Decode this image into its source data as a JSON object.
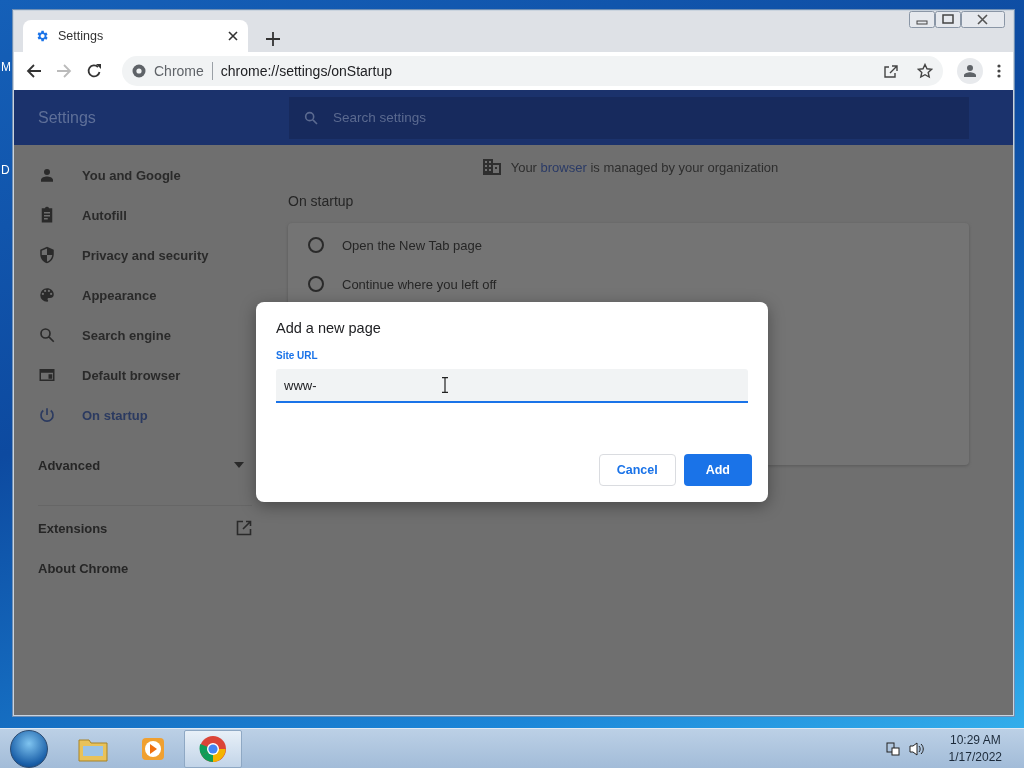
{
  "desktop": {
    "edge_labels": [
      "M",
      "D"
    ]
  },
  "browser": {
    "tabs": [
      {
        "title": "Settings",
        "selected": true
      }
    ],
    "omnibox": {
      "chip": "Chrome",
      "url": "chrome://settings/onStartup"
    }
  },
  "settings": {
    "title": "Settings",
    "search": {
      "placeholder": "Search settings"
    },
    "sidebar": {
      "items": [
        {
          "label": "You and Google",
          "kind": "person",
          "selected": false
        },
        {
          "label": "Autofill",
          "kind": "clipboard",
          "selected": false
        },
        {
          "label": "Privacy and security",
          "kind": "shield",
          "selected": false
        },
        {
          "label": "Appearance",
          "kind": "palette",
          "selected": false
        },
        {
          "label": "Search engine",
          "kind": "search",
          "selected": false
        },
        {
          "label": "Default browser",
          "kind": "browser",
          "selected": false
        },
        {
          "label": "On startup",
          "kind": "power",
          "selected": true
        }
      ],
      "advanced": {
        "label": "Advanced",
        "expanded": false
      },
      "links": [
        {
          "label": "Extensions",
          "external": true
        },
        {
          "label": "About Chrome",
          "external": false
        }
      ]
    },
    "managed_notice": {
      "before": "Your",
      "link": "browser",
      "after": "is managed by your organization"
    },
    "section_title": "On startup",
    "options": [
      {
        "label": "Open the New Tab page",
        "selected": false
      },
      {
        "label": "Continue where you left off",
        "selected": false
      }
    ]
  },
  "dialog": {
    "title": "Add a new page",
    "field": {
      "label": "Site URL",
      "value": "www-"
    },
    "buttons": [
      {
        "label": "Cancel",
        "kind": "secondary"
      },
      {
        "label": "Add",
        "kind": "primary"
      }
    ]
  },
  "taskbar": {
    "apps": [
      {
        "kind": "explorer",
        "selected": false
      },
      {
        "kind": "media",
        "selected": false
      },
      {
        "kind": "chrome",
        "selected": true
      }
    ],
    "clock": {
      "time": "10:29 AM",
      "date": "1/17/2022"
    }
  }
}
